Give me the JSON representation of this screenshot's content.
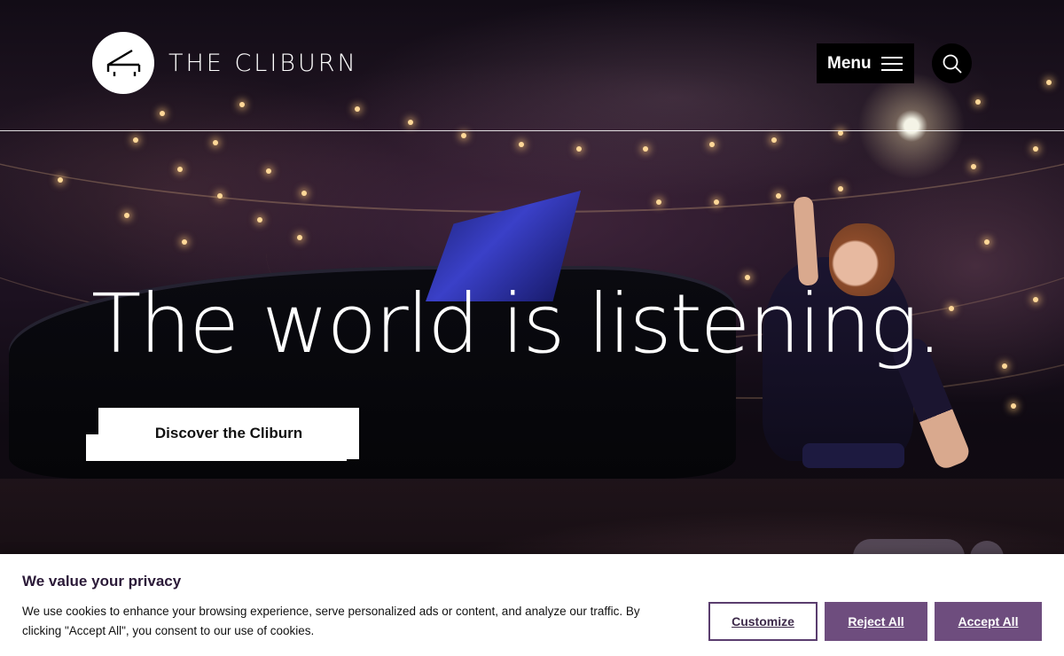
{
  "header": {
    "brand_name": "THE CLIBURN",
    "menu_label": "Menu"
  },
  "hero": {
    "headline": "The world is listening.",
    "cta_label": "Discover the Cliburn"
  },
  "cookie_banner": {
    "title": "We value your privacy",
    "body": "We use cookies to enhance your browsing experience, serve personalized ads or content, and analyze our traffic. By clicking \"Accept All\", you consent to our use of cookies.",
    "customize_label": "Customize",
    "reject_label": "Reject All",
    "accept_label": "Accept All"
  },
  "colors": {
    "brand_purple": "#6e4d7e",
    "title_purple": "#2b1a38"
  },
  "icons": {
    "logo": "grand-piano-icon",
    "menu": "hamburger-icon",
    "search": "search-icon"
  }
}
